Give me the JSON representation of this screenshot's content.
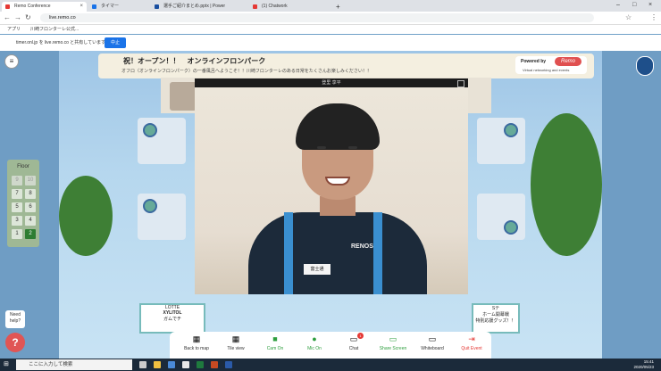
{
  "browser": {
    "tabs": [
      {
        "label": "Remo Conference",
        "color": "#e53935"
      },
      {
        "label": "タイマー",
        "color": "#1a73e8"
      },
      {
        "label": "選手ご紹介まとめ.pptx | Power",
        "color": "#1a4fa0"
      },
      {
        "label": "(1) Chatwork",
        "color": "#e53935"
      }
    ],
    "new_tab": "+",
    "address": "live.remo.co",
    "bookmarks": [
      "アプリ",
      "川崎フロンターレ公式..."
    ],
    "share_notice": "timer.onl.jp を live.remo.co と共有しています",
    "share_stop": "中止"
  },
  "event": {
    "banner_title": "祝！オープン！！　オンラインフロンパーク",
    "banner_sub": "オフロ（オンラインフロンパーク）の一番風呂へようこそ！！川崎フロンターレのある日常をたくさんお楽しみください！！",
    "powered_by": "Powered by",
    "remo_logo": "Remo",
    "remo_tag": "Virtual networking and events"
  },
  "floor": {
    "label": "Floor",
    "buttons": [
      {
        "num": "9",
        "state": "dim"
      },
      {
        "num": "10",
        "state": "dim"
      },
      {
        "num": "7",
        "state": "normal"
      },
      {
        "num": "8",
        "state": "normal"
      },
      {
        "num": "5",
        "state": "normal"
      },
      {
        "num": "6",
        "state": "normal"
      },
      {
        "num": "3",
        "state": "normal"
      },
      {
        "num": "4",
        "state": "normal"
      },
      {
        "num": "1",
        "state": "normal"
      },
      {
        "num": "2",
        "state": "selected"
      }
    ]
  },
  "video": {
    "name": "登里 享平",
    "jersey_sponsor": "富士通",
    "jersey_brand": "RENOS"
  },
  "posters": {
    "left": [
      "LOTTE",
      "XYLITOL",
      "ガムでチ"
    ],
    "right": [
      "Sテ",
      "ホーム開幕戦",
      "特別応援グッズ！！"
    ]
  },
  "toolbar": {
    "items": [
      {
        "label": "Back to map",
        "icon": "map-icon",
        "glyph": "▦",
        "tone": "default"
      },
      {
        "label": "Tile view",
        "icon": "grid-icon",
        "glyph": "▦",
        "tone": "default"
      },
      {
        "label": "Cam On",
        "icon": "camera-icon",
        "glyph": "■",
        "tone": "green"
      },
      {
        "label": "Mic On",
        "icon": "mic-icon",
        "glyph": "●",
        "tone": "green"
      },
      {
        "label": "Chat",
        "icon": "chat-icon",
        "glyph": "▭",
        "tone": "default"
      },
      {
        "label": "Share Screen",
        "icon": "share-screen-icon",
        "glyph": "▭",
        "tone": "green"
      },
      {
        "label": "Whiteboard",
        "icon": "whiteboard-icon",
        "glyph": "▭",
        "tone": "default"
      },
      {
        "label": "Quit Event",
        "icon": "exit-icon",
        "glyph": "⇥",
        "tone": "red"
      }
    ],
    "chat_badge": "1"
  },
  "help": {
    "bubble": "Need help?",
    "glyph": "?"
  },
  "taskbar": {
    "search_placeholder": "ここに入力して検索",
    "time": "15:41",
    "date": "2020/05/23"
  }
}
